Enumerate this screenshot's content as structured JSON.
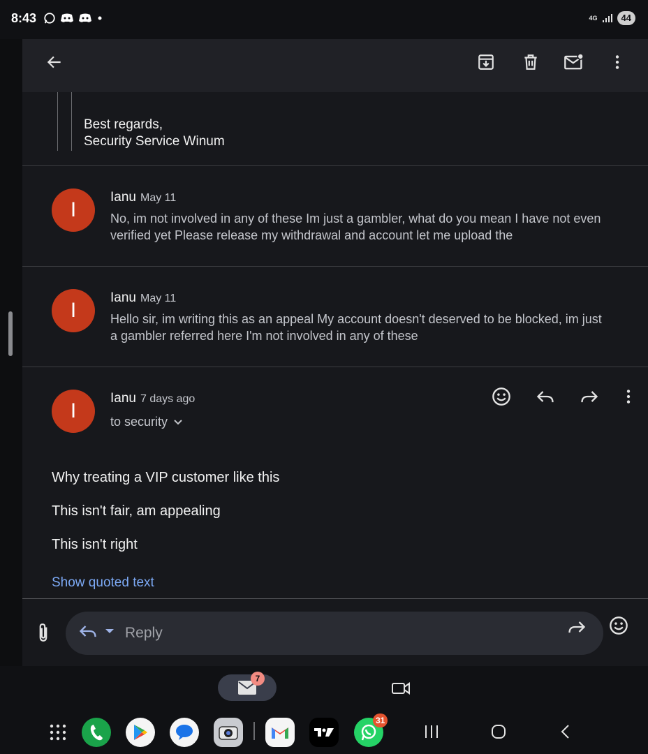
{
  "status_bar": {
    "time": "8:43",
    "battery": "44",
    "network": "4G",
    "notification_icons": [
      "whatsapp-icon",
      "discord-icon",
      "discord-icon",
      "dot-icon"
    ]
  },
  "app_bar": {
    "actions": [
      "back-arrow-icon",
      "archive-icon",
      "delete-icon",
      "mark-unread-icon",
      "more-vert-icon"
    ]
  },
  "quoted_signature": {
    "line1": "Best regards,",
    "line2": "Security Service Winum"
  },
  "messages": [
    {
      "avatar_letter": "I",
      "sender": "Ianu",
      "date": "May 11",
      "snippet_line1": "No, im not involved in any of these Im just a gambler, what do you mean I have not even",
      "snippet_line2": "verified yet Please release my withdrawal and account let me upload the"
    },
    {
      "avatar_letter": "I",
      "sender": "Ianu",
      "date": "May 11",
      "snippet_line1": "Hello sir, im writing this as an appeal My account doesn't deserved to be blocked, im just",
      "snippet_line2": "a gambler referred here I'm not involved in any of these"
    }
  ],
  "open_message": {
    "avatar_letter": "I",
    "sender": "Ianu",
    "date": "7 days ago",
    "recipient": "to security",
    "body": [
      "Why treating a VIP customer like this",
      "This isn't fair, am appealing",
      "This isn't right"
    ],
    "show_quoted": "Show quoted text"
  },
  "reply_bar": {
    "placeholder": "Reply"
  },
  "taskbar": {
    "mail_badge": "7",
    "whatsapp_badge": "31",
    "apps": [
      "apps-grid-icon",
      "phone-icon",
      "play-store-icon",
      "messages-icon",
      "camera-icon",
      "gmail-icon",
      "tradingview-icon",
      "whatsapp-icon"
    ],
    "nav": [
      "recents-icon",
      "home-icon",
      "back-icon"
    ]
  },
  "colors": {
    "avatar": "#c4391b",
    "link": "#7ca9f5",
    "background": "#17181c"
  }
}
